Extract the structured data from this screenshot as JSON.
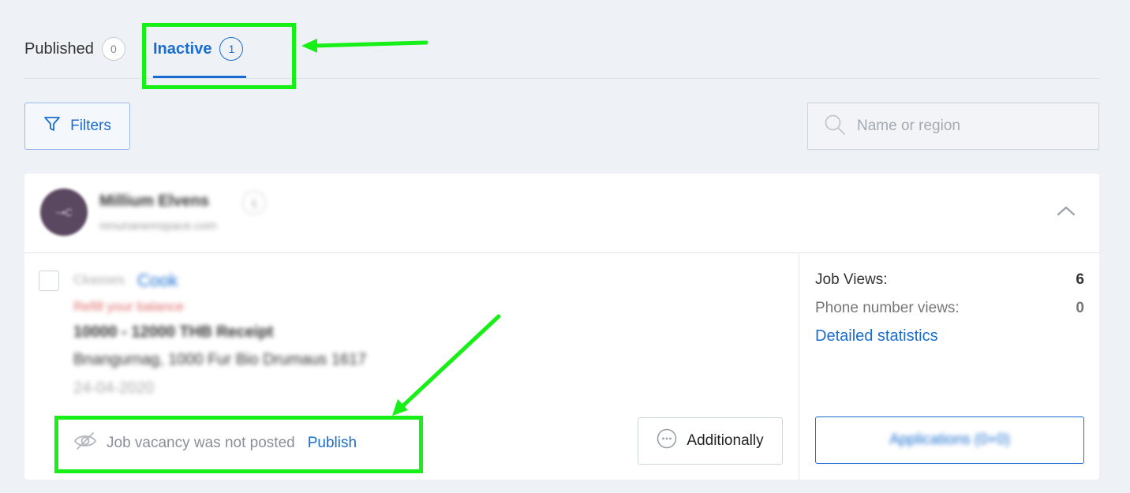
{
  "tabs": [
    {
      "label": "Published",
      "count": "0"
    },
    {
      "label": "Inactive",
      "count": "1"
    }
  ],
  "toolbar": {
    "filters_label": "Filters"
  },
  "search": {
    "placeholder": "Name or region"
  },
  "owner": {
    "avatar_text": "~•C",
    "name": "Millium Elvens",
    "badge": "1",
    "email": "renunanemspace.com"
  },
  "job": {
    "prefix": "Ckasses",
    "title": "Cook",
    "warning": "Refill your balance",
    "line1": "10000 - 12000 THB Receipt",
    "line2": "Bnangurnag, 1000 Fur Bio Drumaus 1617",
    "line3": "24-04-2020",
    "status_text": "Job vacancy was not posted",
    "publish_label": "Publish",
    "more_label": "Additionally"
  },
  "stats": {
    "job_views_label": "Job Views:",
    "job_views_value": "6",
    "phone_views_label": "Phone number views:",
    "phone_views_value": "0",
    "detailed_label": "Detailed statistics",
    "applications_label": "Applications (0+0)"
  },
  "colors": {
    "accent": "#1a6dd0",
    "highlight": "#16f016",
    "background": "#eef1f6"
  }
}
